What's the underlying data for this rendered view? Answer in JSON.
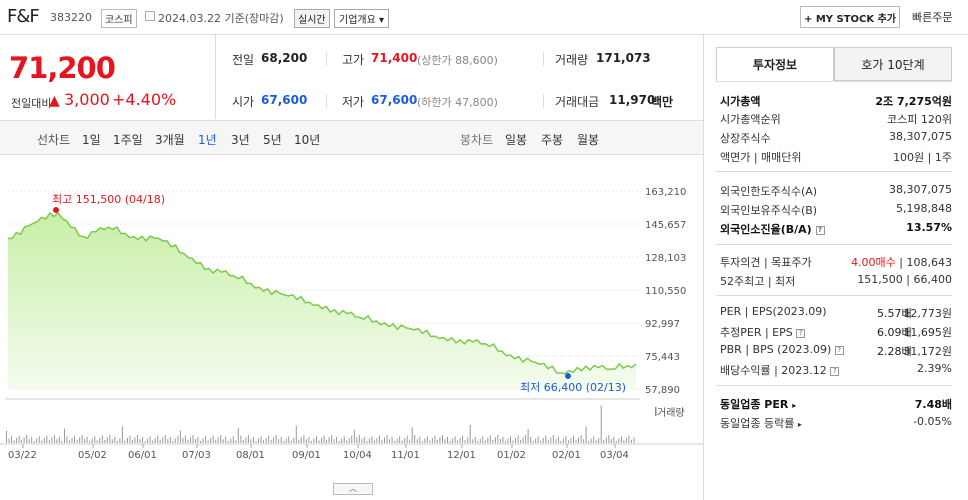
{
  "header": {
    "company_name": "F&F",
    "stock_code": "383220",
    "market": "코스피",
    "date_text": "2024.03.22 기준(장마감)",
    "realtime": "실시간",
    "company_info": "기업개요",
    "mystock": "+ MY STOCK 추가",
    "quick_order": "빠른주문"
  },
  "price": {
    "current": "71,200",
    "change_label": "전일대비",
    "change_arrow": "▲",
    "change_amount": "3,000",
    "change_pct": "+4.40%"
  },
  "stats": {
    "prev_close_label": "전일",
    "prev_close": "68,200",
    "high_label": "고가",
    "high": "71,400",
    "upper_limit": "(상한가 88,600)",
    "volume_label": "거래량",
    "volume": "171,073",
    "open_label": "시가",
    "open": "67,600",
    "low_label": "저가",
    "low": "67,600",
    "lower_limit": "(하한가 47,800)",
    "amount_label": "거래대금",
    "amount": "11,970",
    "amount_unit": "백만"
  },
  "tabs": {
    "line_chart": "선차트",
    "periods": [
      "1일",
      "1주일",
      "3개월",
      "1년",
      "3년",
      "5년",
      "10년"
    ],
    "active": "1년",
    "candle_chart": "봉차트",
    "candle_periods": [
      "일봉",
      "주봉",
      "월봉"
    ]
  },
  "chart_data": {
    "type": "area",
    "x": [
      "03/22",
      "04/05",
      "04/18",
      "05/02",
      "05/20",
      "06/03",
      "06/20",
      "07/03",
      "07/20",
      "08/01",
      "08/20",
      "09/01",
      "09/20",
      "10/04",
      "10/20",
      "11/01",
      "11/20",
      "12/01",
      "12/20",
      "01/02",
      "01/20",
      "02/01",
      "02/13",
      "02/28",
      "03/04",
      "03/22"
    ],
    "values": [
      138000,
      146000,
      151500,
      139000,
      144000,
      139000,
      138000,
      130000,
      122000,
      118000,
      112000,
      108000,
      104000,
      100000,
      96000,
      93000,
      90000,
      86000,
      84000,
      82000,
      76000,
      72000,
      66400,
      70000,
      68500,
      71200
    ],
    "yticks": [
      "163,210",
      "145,657",
      "128,103",
      "110,550",
      "92,997",
      "75,443",
      "57,890"
    ],
    "ylim": [
      57890,
      163210
    ],
    "xticks": [
      "03/22",
      "05/02",
      "06/01",
      "07/03",
      "08/01",
      "09/01",
      "10/04",
      "11/01",
      "12/01",
      "01/02",
      "02/01",
      "03/04"
    ],
    "max_label": "최고 151,500 (04/18)",
    "min_label": "최저 66,400 (02/13)",
    "volume_label": "거래량",
    "line_color": "#7cc94f",
    "fill_color": "#c8efa8"
  },
  "right_panel": {
    "tab_invest": "투자정보",
    "tab_hoga": "호가 10단계",
    "rows1": [
      {
        "label": "시가총액",
        "value": "2조 7,275억원",
        "bold": true
      },
      {
        "label": "시가총액순위",
        "value": "코스피 120위"
      },
      {
        "label": "상장주식수",
        "value": "38,307,075"
      },
      {
        "label": "액면가 | 매매단위",
        "value": "100원 | 1주"
      }
    ],
    "rows2": [
      {
        "label": "외국인한도주식수(A)",
        "value": "38,307,075"
      },
      {
        "label": "외국인보유주식수(B)",
        "value": "5,198,848"
      },
      {
        "label": "외국인소진율(B/A)",
        "value": "13.57%",
        "bold": true
      }
    ],
    "rows3": [
      {
        "label": "투자의견 | 목표주가",
        "value_red": "4.00매수",
        "value": "108,643"
      },
      {
        "label": "52주최고 | 최저",
        "value": "151,500 | 66,400"
      }
    ],
    "rows4": [
      {
        "label": "PER | EPS(2023.09)",
        "v1": "5.57배",
        "v2": "12,773원"
      },
      {
        "label": "추정PER | EPS",
        "v1": "6.09배",
        "v2": "11,695원"
      },
      {
        "label": "PBR | BPS (2023.09)",
        "v1": "2.28배",
        "v2": "31,172원"
      },
      {
        "label": "배당수익률 | 2023.12",
        "v1": "",
        "v2": "2.39%"
      }
    ],
    "rows5": [
      {
        "label": "동일업종 PER",
        "value": "7.48배",
        "bold": true
      },
      {
        "label": "동일업종 등락률",
        "value": "-0.05%",
        "blue": true
      }
    ]
  }
}
